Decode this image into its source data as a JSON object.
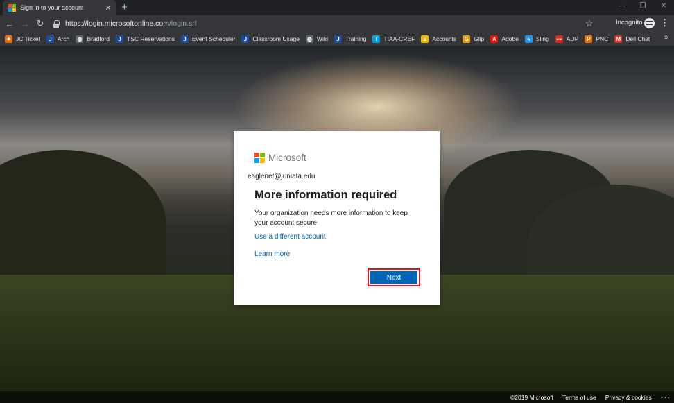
{
  "browser": {
    "tab": {
      "title": "Sign in to your account",
      "close": "✕"
    },
    "new_tab": "+",
    "window_controls": {
      "minimize": "—",
      "restore": "❐",
      "close": "✕"
    },
    "nav": {
      "back": "←",
      "forward": "→",
      "reload": "↻"
    },
    "url": {
      "host": "https://login.microsoftonline.com",
      "path": "/login.srf"
    },
    "star": "☆",
    "profile": "Incognito",
    "menu": "⋮",
    "bookmarks": [
      {
        "label": "JC Ticket",
        "icon": "jc-ticket-icon",
        "glyph": "✦",
        "color": "#e8710a"
      },
      {
        "label": "Arch",
        "icon": "j-icon",
        "glyph": "J",
        "color": "#1a4c9c"
      },
      {
        "label": "Bradford",
        "icon": "globe-icon",
        "glyph": "◍",
        "color": "#5f6368"
      },
      {
        "label": "TSC Reservations",
        "icon": "j-icon",
        "glyph": "J",
        "color": "#1a4c9c"
      },
      {
        "label": "Event Scheduler",
        "icon": "j-icon",
        "glyph": "J",
        "color": "#1a4c9c"
      },
      {
        "label": "Classroom Usage",
        "icon": "j-icon",
        "glyph": "J",
        "color": "#1a4c9c"
      },
      {
        "label": "Wiki",
        "icon": "globe-icon",
        "glyph": "◍",
        "color": "#5f6368"
      },
      {
        "label": "Training",
        "icon": "j-icon",
        "glyph": "J",
        "color": "#1a4c9c"
      },
      {
        "label": "TIAA-CREF",
        "icon": "tiaa-icon",
        "glyph": "T",
        "color": "#00a3e0"
      },
      {
        "label": "Accounts",
        "icon": "accounts-icon",
        "glyph": "▲",
        "color": "#f4b400"
      },
      {
        "label": "Glip",
        "icon": "glip-icon",
        "glyph": "G",
        "color": "#f29b05"
      },
      {
        "label": "Adobe",
        "icon": "adobe-icon",
        "glyph": "A",
        "color": "#eb1000"
      },
      {
        "label": "Sling",
        "icon": "sling-icon",
        "glyph": "ϟ",
        "color": "#2196f3"
      },
      {
        "label": "ADP",
        "icon": "adp-icon",
        "glyph": "ADP",
        "color": "#d0271d"
      },
      {
        "label": "PNC",
        "icon": "pnc-icon",
        "glyph": "P",
        "color": "#ef6c00"
      },
      {
        "label": "Dell Chat",
        "icon": "gmail-icon",
        "glyph": "M",
        "color": "#d93025"
      }
    ],
    "bookmarks_more": "»"
  },
  "signin": {
    "logo_text": "Microsoft",
    "logo_colors": [
      "#f25022",
      "#7fba00",
      "#00a4ef",
      "#ffb900"
    ],
    "identity": "eaglenet@juniata.edu",
    "title": "More information required",
    "description": "Your organization needs more information to keep your account secure",
    "use_different_account": "Use a different account",
    "learn_more": "Learn more",
    "next": "Next"
  },
  "footer": {
    "copyright": "©2019 Microsoft",
    "terms": "Terms of use",
    "privacy": "Privacy & cookies",
    "more": "· · ·"
  }
}
